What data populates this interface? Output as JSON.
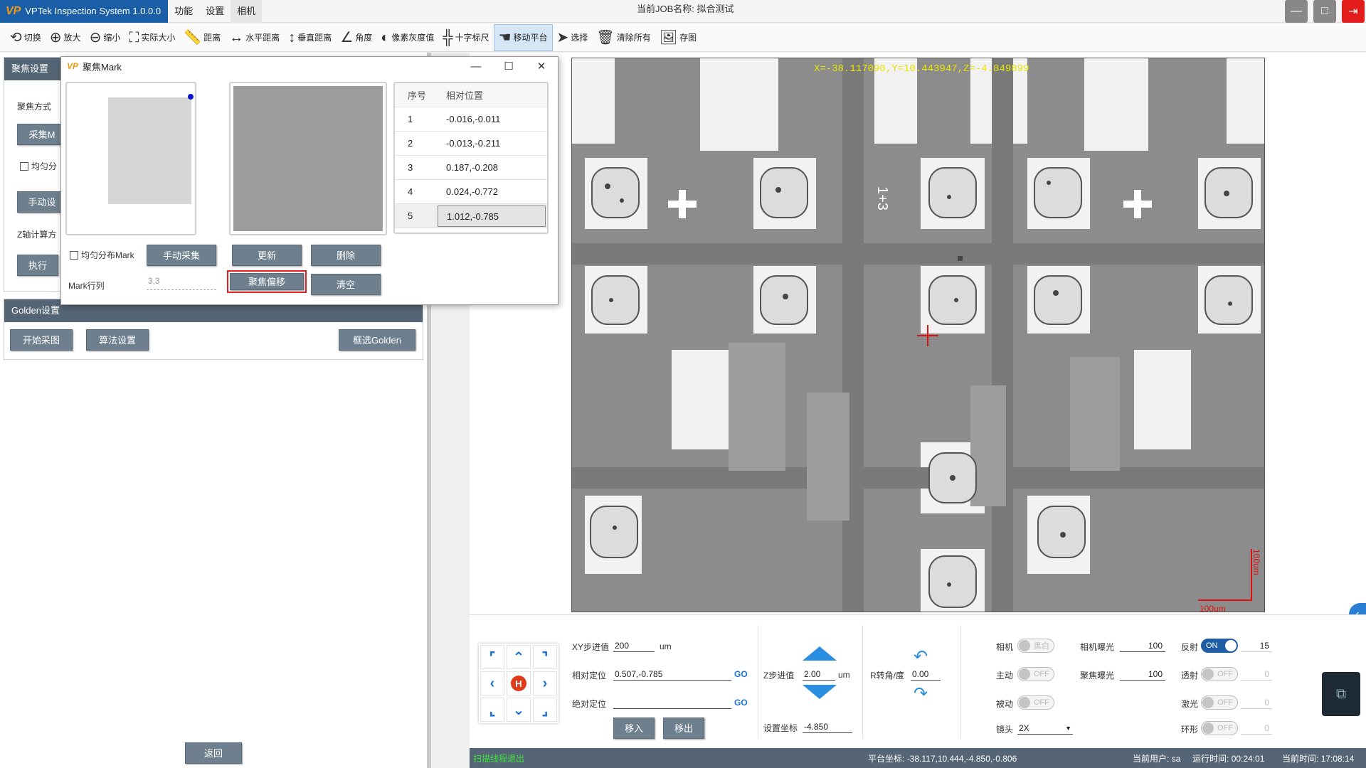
{
  "titlebar": {
    "app_title": "VPTek Inspection System 1.0.0.0",
    "logo": "VP",
    "menu": [
      "功能",
      "设置",
      "相机"
    ],
    "job_label": "当前JOB名称:",
    "job_name": "拟合测试"
  },
  "toolbar": [
    {
      "label": "切换",
      "icon": "switch-icon",
      "glyph": "⟲"
    },
    {
      "label": "放大",
      "icon": "zoom-in-icon",
      "glyph": "⊕"
    },
    {
      "label": "缩小",
      "icon": "zoom-out-icon",
      "glyph": "⊖"
    },
    {
      "label": "实际大小",
      "icon": "fit-size-icon",
      "glyph": "⛶"
    },
    {
      "label": "距离",
      "icon": "ruler-icon",
      "glyph": "📏"
    },
    {
      "label": "水平距离",
      "icon": "horizontal-distance-icon",
      "glyph": "↔"
    },
    {
      "label": "垂直距离",
      "icon": "vertical-distance-icon",
      "glyph": "↕"
    },
    {
      "label": "角度",
      "icon": "angle-icon",
      "glyph": "∠"
    },
    {
      "label": "像素灰度值",
      "icon": "gray-value-icon",
      "glyph": "◐"
    },
    {
      "label": "十字标尺",
      "icon": "crosshair-ruler-icon",
      "glyph": "╬"
    },
    {
      "label": "移动平台",
      "icon": "hand-icon",
      "glyph": "☚"
    },
    {
      "label": "选择",
      "icon": "pointer-icon",
      "glyph": "➤"
    },
    {
      "label": "清除所有",
      "icon": "trash-icon",
      "glyph": "🗑"
    },
    {
      "label": "存图",
      "icon": "save-image-icon",
      "glyph": "🖼"
    }
  ],
  "left": {
    "focus_section": "聚焦设置",
    "focus_mode_label": "聚焦方式",
    "collect_btn": "采集M",
    "even_dist": "均匀分",
    "manual_btn": "手动设",
    "z_calc": "Z轴计算方",
    "execute_btn": "执行",
    "golden_section": "Golden设置",
    "start_capture_btn": "开始采图",
    "algo_btn": "算法设置",
    "select_golden_btn": "框选Golden",
    "back_btn": "返回"
  },
  "dialog": {
    "title": "聚焦Mark",
    "logo": "VP",
    "table_headers": [
      "序号",
      "相对位置"
    ],
    "rows": [
      {
        "idx": "1",
        "pos": "-0.016,-0.011"
      },
      {
        "idx": "2",
        "pos": "-0.013,-0.211"
      },
      {
        "idx": "3",
        "pos": "0.187,-0.208"
      },
      {
        "idx": "4",
        "pos": "0.024,-0.772"
      },
      {
        "idx": "5",
        "pos": "1.012,-0.785"
      }
    ],
    "even_mark": "均匀分布Mark",
    "manual_collect": "手动采集",
    "update": "更新",
    "delete": "删除",
    "mark_rowcol_label": "Mark行列",
    "mark_rowcol_value": "3,3",
    "focus_offset": "聚焦偏移",
    "clear": "清空"
  },
  "viewer": {
    "coords": "X=-38.117090,Y=10.443947,Z=-4.849899",
    "scale_h": "100um",
    "scale_v": "100um",
    "die_label": "1+3"
  },
  "bottom": {
    "xy_step_label": "XY步进值",
    "xy_step_value": "200",
    "xy_unit": "um",
    "rel_pos_label": "相对定位",
    "rel_pos_value": "0.507,-0.785",
    "abs_pos_label": "绝对定位",
    "abs_pos_value": "",
    "go": "GO",
    "move_in": "移入",
    "move_out": "移出",
    "z_step_label": "Z步进值",
    "z_step_value": "2.00",
    "z_unit": "um",
    "set_coord_label": "设置坐标",
    "set_coord_value": "-4.850",
    "r_label": "R转角/度",
    "r_value": "0.00",
    "camera_label": "相机",
    "camera_toggle": "黑白",
    "active_label": "主动",
    "passive_label": "被动",
    "lens_label": "镜头",
    "lens_value": "2X",
    "cam_exposure_label": "相机曝光",
    "cam_exposure_value": "100",
    "focus_exposure_label": "聚焦曝光",
    "focus_exposure_value": "100",
    "reflect_label": "反射",
    "reflect_value": "15",
    "transmit_label": "透射",
    "transmit_value": "0",
    "laser_label": "激光",
    "laser_value": "0",
    "ring_label": "环形",
    "ring_value": "0",
    "on": "ON",
    "off": "OFF",
    "home": "H"
  },
  "status": {
    "message": "扫描线程退出",
    "platform_label": "平台坐标:",
    "platform_value": "-38.117,10.444,-4.850,-0.806",
    "user_label": "当前用户:",
    "user_value": "sa",
    "runtime_label": "运行时间:",
    "runtime_value": "00:24:01",
    "time_label": "当前时间:",
    "time_value": "17:08:14"
  },
  "colors": {
    "accent": "#1a5ea8",
    "panel_head": "#536474",
    "button": "#6e7f8e",
    "status_msg": "#39e639",
    "coords": "#e6e600",
    "red_mark": "#e01010"
  }
}
